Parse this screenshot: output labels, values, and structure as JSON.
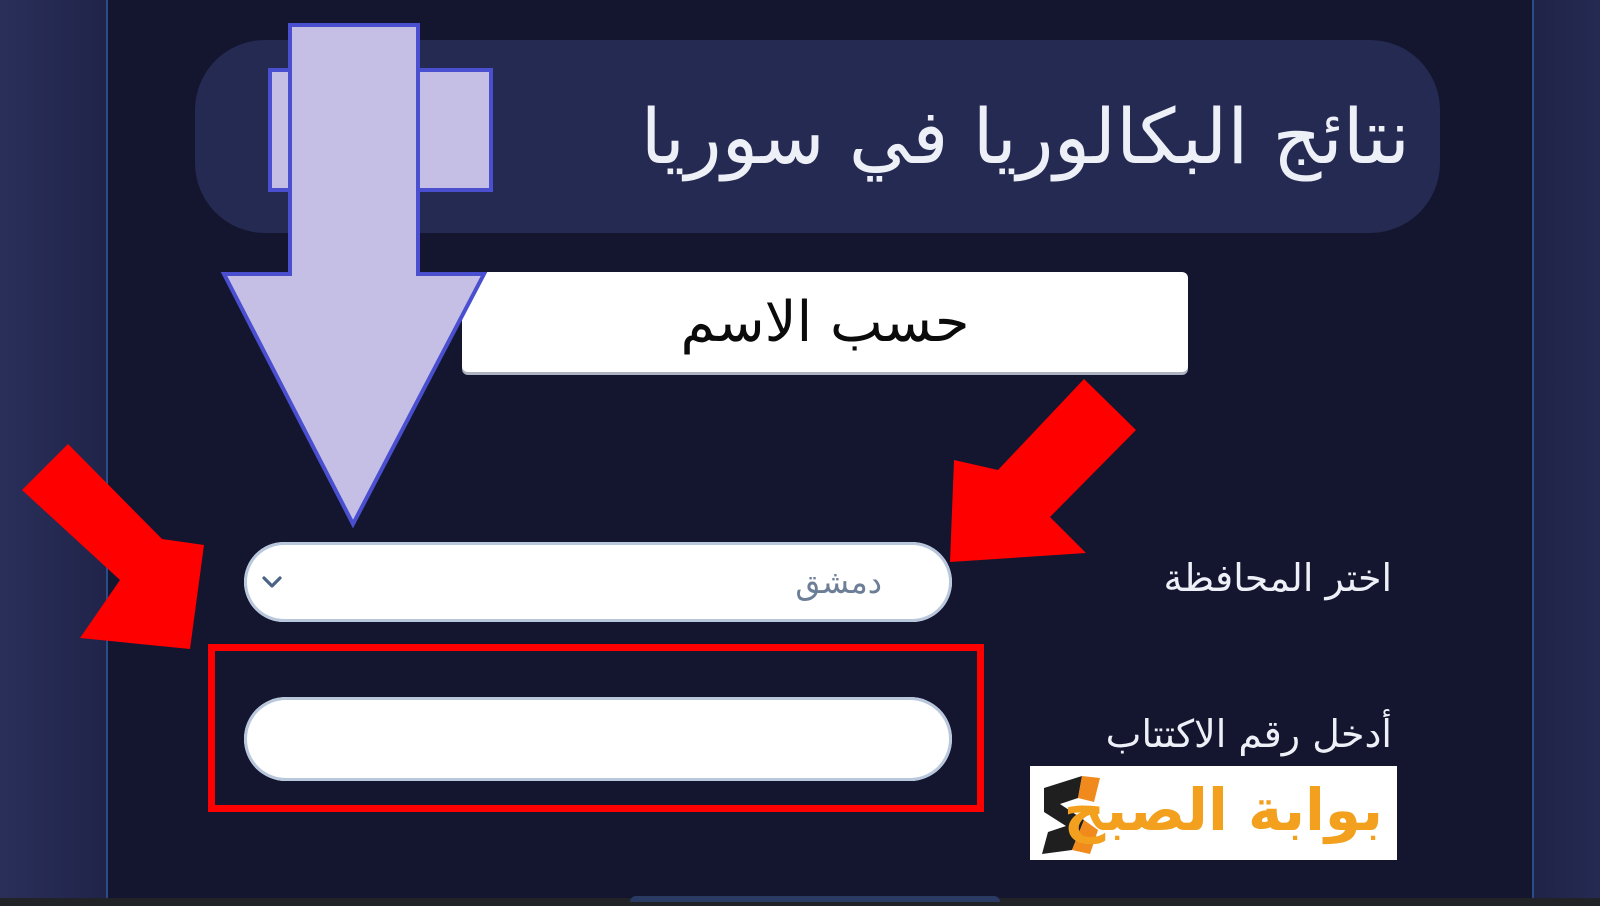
{
  "page": {
    "title": "نتائج البكالوريا في سوريا",
    "search_mode_label": "حسب الاسم"
  },
  "form": {
    "governorate": {
      "label": "اختر المحافظة",
      "selected": "دمشق"
    },
    "exam_number": {
      "label": "أدخل رقم الاكتتاب",
      "value": ""
    }
  },
  "watermark": {
    "logo_text": "بوابة الصبح"
  },
  "icons": {
    "dropdown": "chevron-down-icon",
    "big_arrow": "arrow-down-icon",
    "red_arrows": "red-arrow-icon"
  },
  "colors": {
    "panel_bg": "#141630",
    "title_bg": "#252a52",
    "annotation_red": "#ff0000",
    "annotation_arrow_fill": "#c5bfe6",
    "annotation_arrow_stroke": "#4a4fd0",
    "logo_orange": "#f2a01d"
  }
}
